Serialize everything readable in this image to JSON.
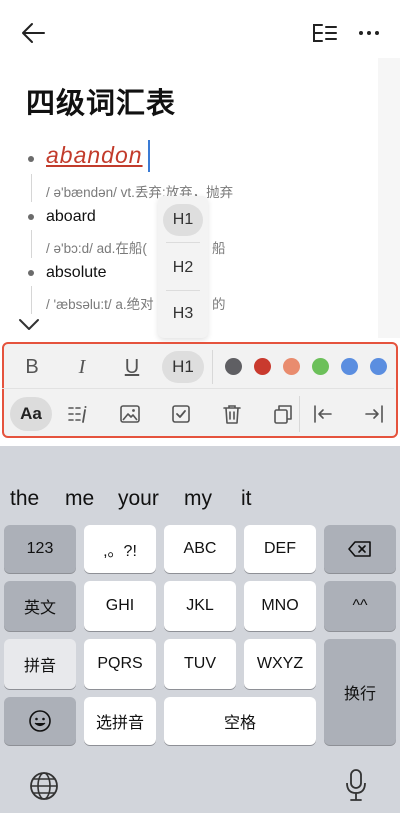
{
  "header": {
    "back_icon": "arrow-left-icon",
    "outline_icon": "outline-icon",
    "more_icon": "more-horizontal-icon"
  },
  "document": {
    "title": "四级词汇表",
    "entries": [
      {
        "word": "abandon",
        "definition": "/ ə'bændən/ vt.丢弃;放弃，抛弃"
      },
      {
        "word": "aboard",
        "definition": "/ ə'bɔ:d/ ad.在船(",
        "definition_tail": "船"
      },
      {
        "word": "absolute",
        "definition": "/ 'æbsəlu:t/ a.绝对",
        "definition_tail": "的"
      }
    ]
  },
  "heading_menu": {
    "items": [
      "H1",
      "H2",
      "H3"
    ],
    "selected": "H1"
  },
  "toolbar": {
    "row1": {
      "bold": "B",
      "italic": "I",
      "underline": "U",
      "heading": "H1",
      "colors": [
        "#5f5f63",
        "#c93a2e",
        "#e98c6e",
        "#6cc05a",
        "#5b8ee0",
        "#5b8ee0"
      ]
    },
    "row2": {
      "text_style": "Aa",
      "icons": [
        "list-icon",
        "image-icon",
        "checkbox-icon",
        "trash-icon",
        "copy-icon",
        "outdent-icon",
        "indent-icon"
      ]
    }
  },
  "keyboard": {
    "suggestions": [
      "the",
      "me",
      "your",
      "my",
      "it"
    ],
    "rows": [
      [
        "123",
        ",。?!",
        "ABC",
        "DEF",
        "backspace"
      ],
      [
        "英文",
        "GHI",
        "JKL",
        "MNO",
        "^^"
      ],
      [
        "拼音",
        "PQRS",
        "TUV",
        "WXYZ",
        "换行"
      ],
      [
        "emoji",
        "选拼音",
        "空格"
      ]
    ],
    "globe_icon": "globe-icon",
    "mic_icon": "microphone-icon"
  }
}
